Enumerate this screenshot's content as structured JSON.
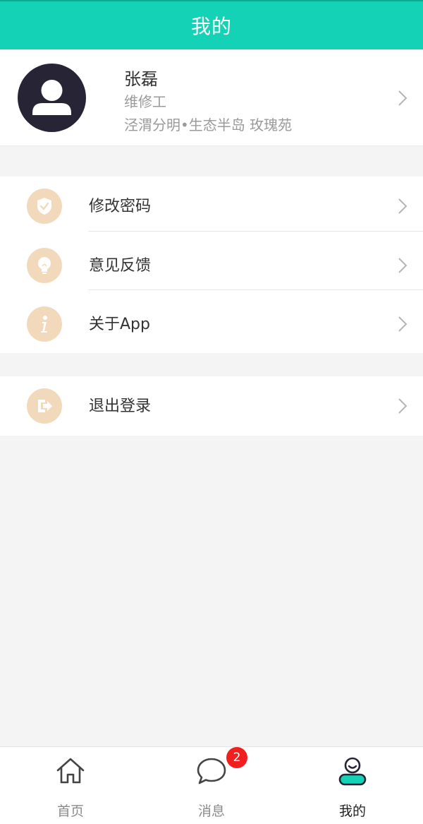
{
  "header": {
    "title": "我的"
  },
  "profile": {
    "name": "张磊",
    "role": "维修工",
    "address": "泾渭分明•生态半岛 玫瑰苑"
  },
  "menu": {
    "items": [
      {
        "label": "修改密码",
        "icon": "shield-check-icon"
      },
      {
        "label": "意见反馈",
        "icon": "lightbulb-icon"
      },
      {
        "label": "关于App",
        "icon": "info-icon"
      }
    ],
    "logout": {
      "label": "退出登录",
      "icon": "logout-icon"
    }
  },
  "tabs": [
    {
      "label": "首页",
      "icon": "home-icon",
      "active": false
    },
    {
      "label": "消息",
      "icon": "chat-bubble-icon",
      "active": false,
      "badge": "2"
    },
    {
      "label": "我的",
      "icon": "user-icon",
      "active": true
    }
  ],
  "colors": {
    "brand": "#14d2b6",
    "icon_circle": "#f2d9bb",
    "badge": "#f02020"
  }
}
